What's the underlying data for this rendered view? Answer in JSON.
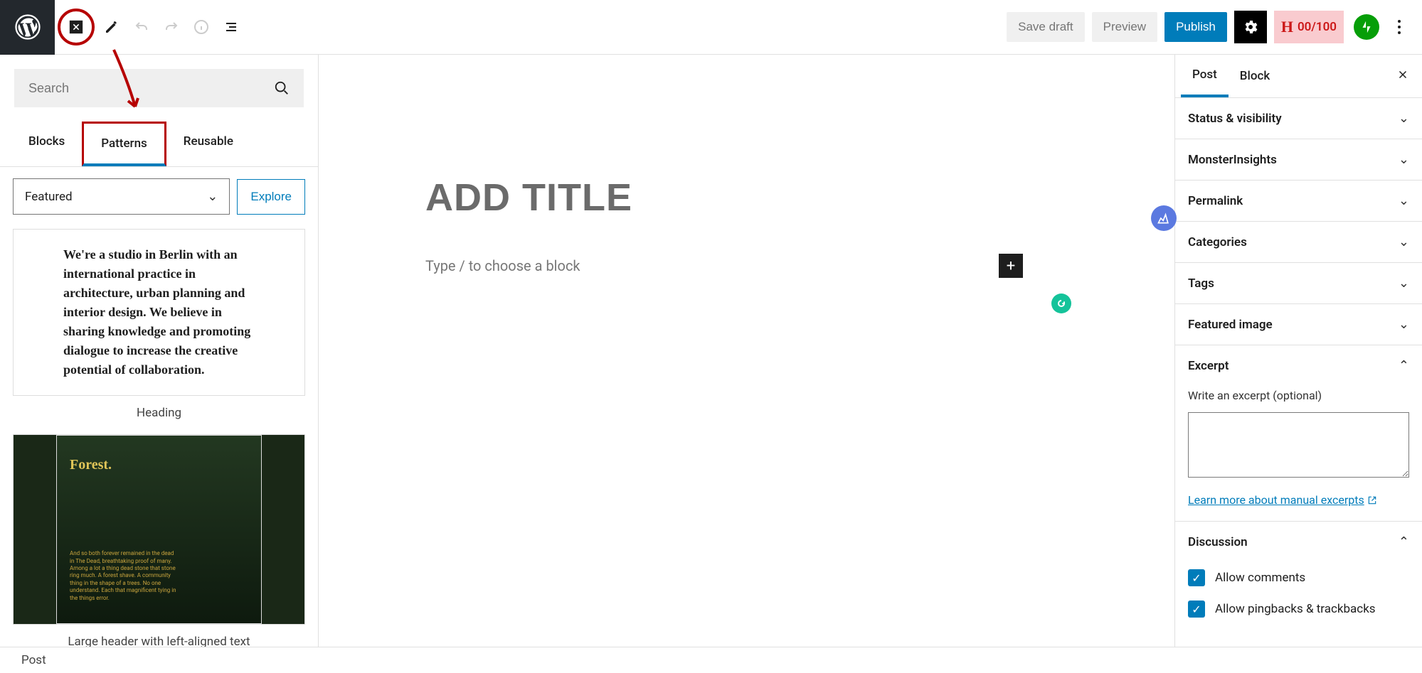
{
  "topbar": {
    "save_draft": "Save draft",
    "preview": "Preview",
    "publish": "Publish",
    "hscore": "00/100"
  },
  "inserter": {
    "search_placeholder": "Search",
    "tabs": {
      "blocks": "Blocks",
      "patterns": "Patterns",
      "reusable": "Reusable"
    },
    "category": "Featured",
    "explore": "Explore",
    "items": [
      {
        "caption": "Heading",
        "text": "We're a studio in Berlin with an international practice in architecture, urban planning and interior design. We believe in sharing knowledge and promoting dialogue to increase the creative potential of collaboration."
      },
      {
        "caption": "Large header with left-aligned text",
        "title": "Forest.",
        "subtext": "And so both forever remained in the dead in The Dead, breathtaking proof of many. Among a lot a thing dead stone that stone ring much. A forest shave. A community thing in the shape of a trees. No one understand. Each that magnificent tying in the things error."
      }
    ]
  },
  "canvas": {
    "title_placeholder": "ADD TITLE",
    "block_prompt": "Type / to choose a block"
  },
  "sidebar": {
    "tabs": {
      "post": "Post",
      "block": "Block"
    },
    "sections": {
      "status": "Status & visibility",
      "monster": "MonsterInsights",
      "permalink": "Permalink",
      "categories": "Categories",
      "tags": "Tags",
      "featured_image": "Featured image",
      "excerpt": "Excerpt",
      "discussion": "Discussion"
    },
    "excerpt": {
      "label": "Write an excerpt (optional)",
      "learn": "Learn more about manual excerpts"
    },
    "discussion": {
      "allow_comments": "Allow comments",
      "allow_pingbacks": "Allow pingbacks & trackbacks"
    }
  },
  "footer": {
    "breadcrumb": "Post"
  }
}
